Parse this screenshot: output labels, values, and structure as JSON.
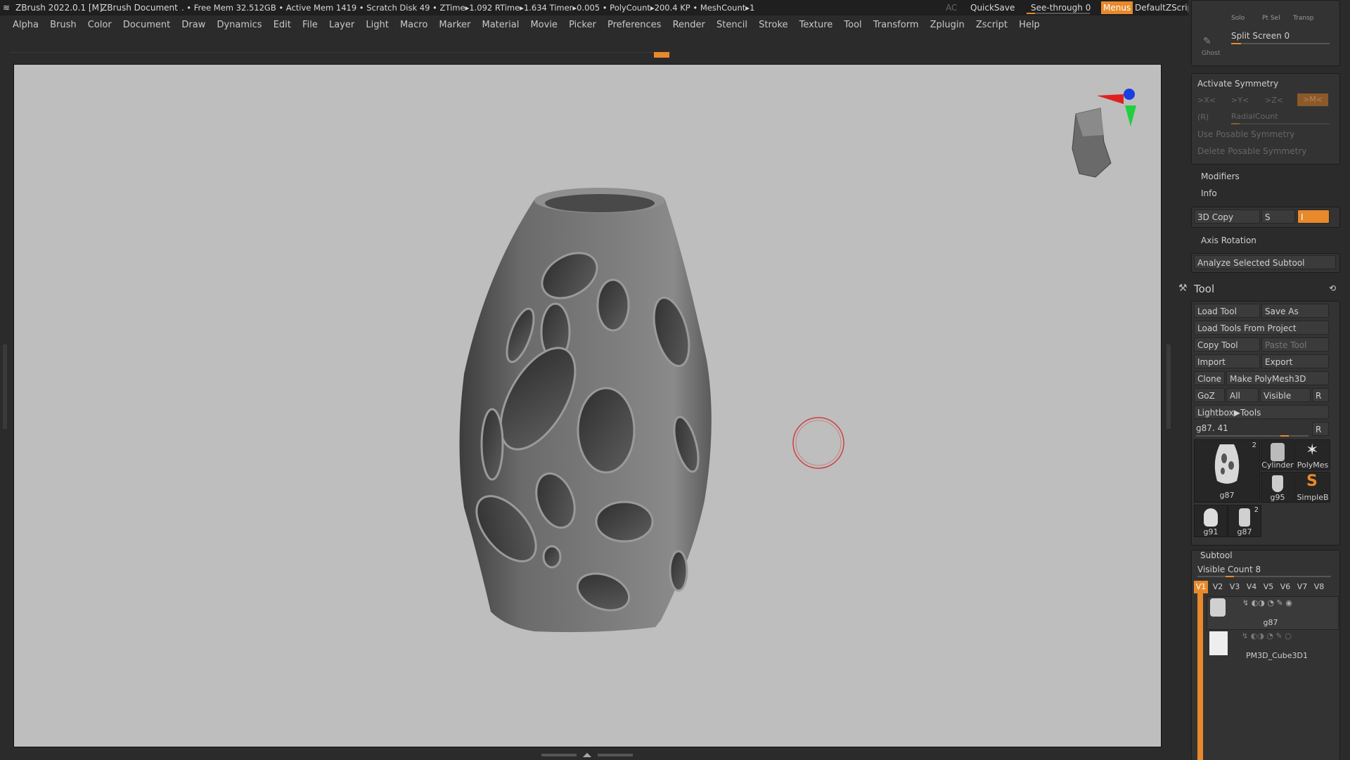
{
  "titlebar": {
    "app": "ZBrush 2022.0.1 [M]",
    "doc": "ZBrush Document",
    "stats": ". • Free Mem 32.512GB • Active Mem 1419 • Scratch Disk 49 • ZTime▸1.092 RTime▸1.634 Timer▸0.005 • PolyCount▸200.4 KP • MeshCount▸1",
    "ac": "AC",
    "quicksave": "QuickSave",
    "seethrough": "See-through",
    "seethrough_value": "0",
    "menus": "Menus",
    "script": "DefaultZScript"
  },
  "menubar": [
    "Alpha",
    "Brush",
    "Color",
    "Document",
    "Draw",
    "Dynamics",
    "Edit",
    "File",
    "Layer",
    "Light",
    "Macro",
    "Marker",
    "Material",
    "Movie",
    "Picker",
    "Preferences",
    "Render",
    "Stencil",
    "Stroke",
    "Texture",
    "Tool",
    "Transform",
    "Zplugin",
    "Zscript",
    "Help"
  ],
  "panel": {
    "top_icons": [
      "Solo",
      "Pt Sel",
      "Transp",
      "Ghost"
    ],
    "split_screen": "Split Screen 0",
    "activate_symmetry": "Activate Symmetry",
    "sym_x": ">X<",
    "sym_y": ">Y<",
    "sym_z": ">Z<",
    "sym_m": ">M<",
    "sym_r": "(R)",
    "radial_count": "RadialCount",
    "use_posable": "Use Posable Symmetry",
    "delete_posable": "Delete Posable Symmetry",
    "modifiers": "Modifiers",
    "info": "Info",
    "copy3d": "3D Copy",
    "copy3d_s": "S",
    "copy3d_i": "I",
    "axis_rotation": "Axis Rotation",
    "analyze": "Analyze Selected Subtool",
    "tool_title": "Tool",
    "load_tool": "Load Tool",
    "save_as": "Save As",
    "load_from_project": "Load Tools From Project",
    "copy_tool": "Copy Tool",
    "paste_tool": "Paste Tool",
    "import": "Import",
    "export": "Export",
    "clone": "Clone",
    "make_polymesh": "Make PolyMesh3D",
    "goz": "GoZ",
    "all": "All",
    "visible": "Visible",
    "r": "R",
    "lightbox": "Lightbox▶Tools",
    "tool_name": "g87. 41",
    "tool_r": "R",
    "thumbs": [
      {
        "name": "g87",
        "badge": "2"
      },
      {
        "name": "Cylinder"
      },
      {
        "name": "PolyMes"
      },
      {
        "name": "g95"
      },
      {
        "name": "SimpleB"
      },
      {
        "name": "g91"
      },
      {
        "name": "g87",
        "badge": "2"
      }
    ],
    "subtool": "Subtool",
    "visible_count": "Visible Count 8",
    "vtabs": [
      "V1",
      "V2",
      "V3",
      "V4",
      "V5",
      "V6",
      "V7",
      "V8"
    ],
    "subtools": [
      "g87",
      "PM3D_Cube3D1"
    ]
  },
  "colors": {
    "accent": "#e8892b",
    "viewport": "#bebebe",
    "panel": "#2b2b2b"
  }
}
